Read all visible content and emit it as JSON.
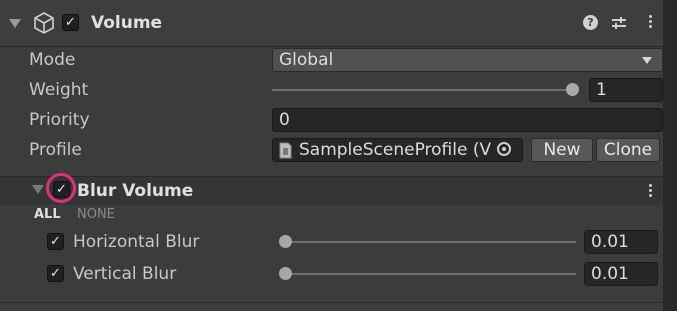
{
  "component": {
    "title": "Volume",
    "enabled": true,
    "icons": [
      "cube-icon",
      "help-icon",
      "presets-icon",
      "more-icon"
    ]
  },
  "fields": {
    "mode": {
      "label": "Mode",
      "value": "Global"
    },
    "weight": {
      "label": "Weight",
      "value": "1",
      "slider_fraction": 1.0
    },
    "priority": {
      "label": "Priority",
      "value": "0"
    },
    "profile": {
      "label": "Profile",
      "value": "SampleSceneProfile (V",
      "new_label": "New",
      "clone_label": "Clone"
    }
  },
  "override": {
    "title": "Blur Volume",
    "enabled": true,
    "all_label": "ALL",
    "none_label": "NONE",
    "params": [
      {
        "label": "Horizontal Blur",
        "value": "0.01",
        "enabled": true,
        "slider_fraction": 0.01
      },
      {
        "label": "Vertical Blur",
        "value": "0.01",
        "enabled": true,
        "slider_fraction": 0.01
      }
    ]
  },
  "colors": {
    "highlight_ring": "#e0307a",
    "background": "#3c3c3c"
  }
}
